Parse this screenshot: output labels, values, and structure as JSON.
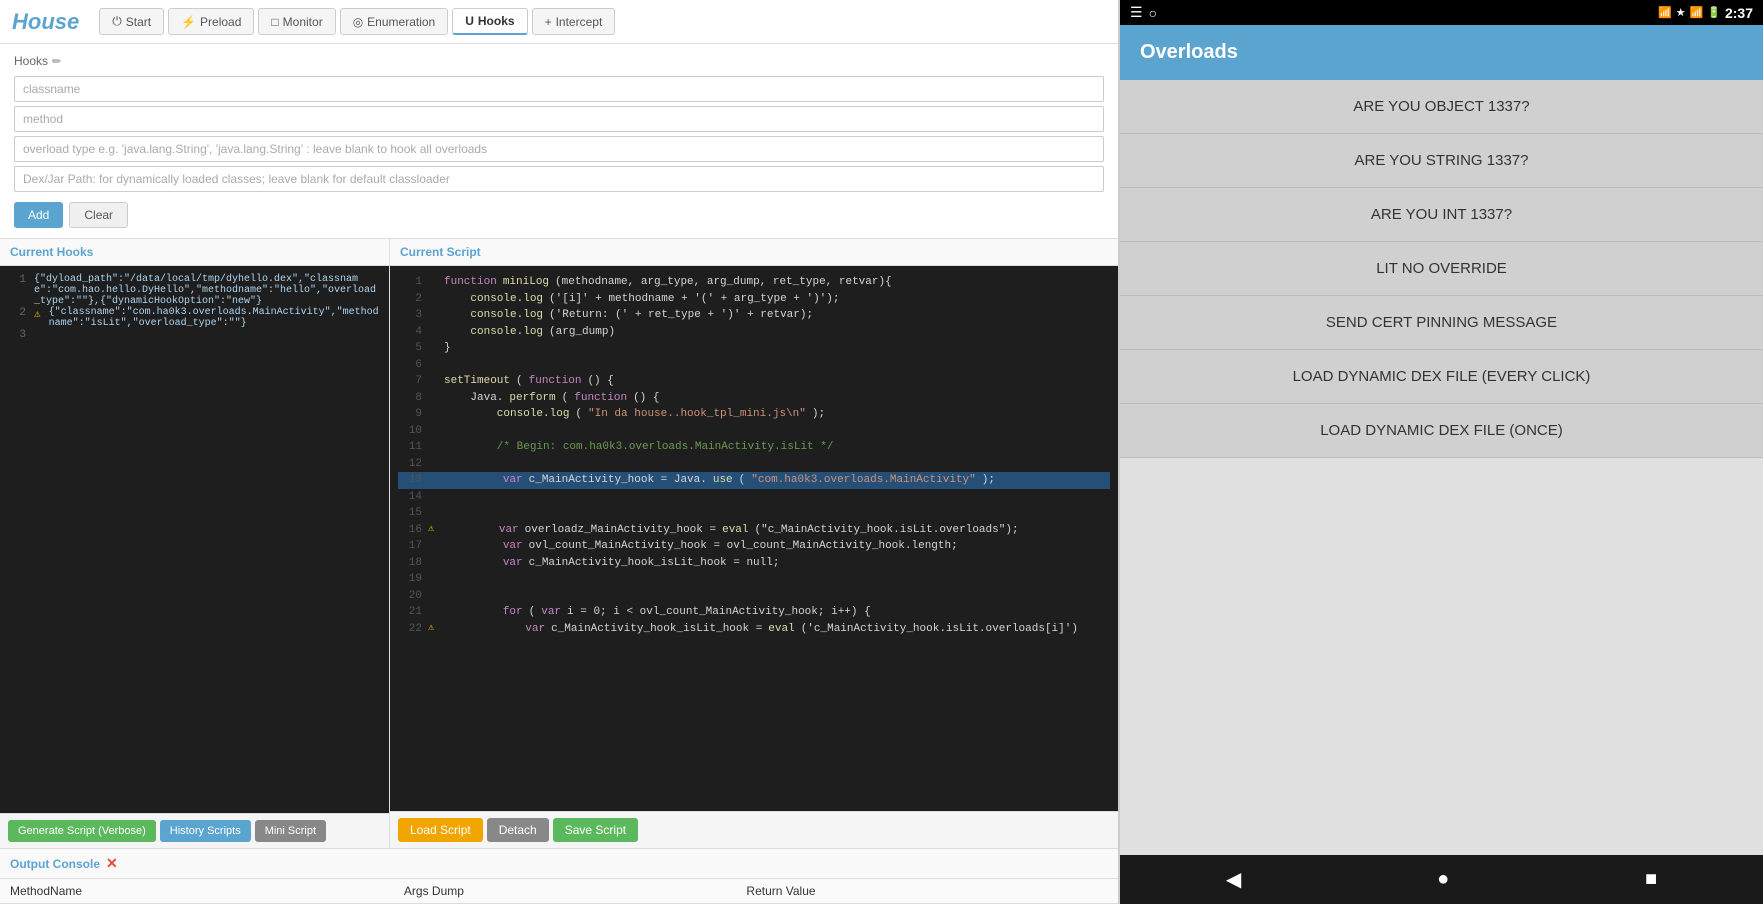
{
  "app": {
    "title": "House"
  },
  "nav": {
    "tabs": [
      {
        "id": "start",
        "label": "Start",
        "icon": "⏻",
        "active": false
      },
      {
        "id": "preload",
        "label": "Preload",
        "icon": "⚡",
        "active": false
      },
      {
        "id": "monitor",
        "label": "Monitor",
        "icon": "□",
        "active": false
      },
      {
        "id": "enumeration",
        "label": "Enumeration",
        "icon": "◎",
        "active": false
      },
      {
        "id": "hooks",
        "label": "Hooks",
        "icon": "U",
        "active": true
      },
      {
        "id": "intercept",
        "label": "Intercept",
        "icon": "+",
        "active": false
      }
    ]
  },
  "hooks": {
    "title": "Hooks",
    "fields": {
      "classname": {
        "placeholder": "classname",
        "value": ""
      },
      "method": {
        "placeholder": "method",
        "value": ""
      },
      "overload": {
        "placeholder": "overload type e.g. 'java.lang.String', 'java.lang.String' : leave blank to hook all overloads",
        "value": ""
      },
      "dexjar": {
        "placeholder": "Dex/Jar Path: for dynamically loaded classes; leave blank for default classloader",
        "value": ""
      }
    },
    "buttons": {
      "add": "Add",
      "clear": "Clear"
    }
  },
  "current_hooks": {
    "title": "Current Hooks",
    "code": [
      {
        "ln": "1",
        "warn": false,
        "text": "{\"dyload_path\":\"/data/local/tmp/dyhello.dex\",\"classname\":\"com.hao.hello.DyHello\",\"methodname\":\"hello\",\"overload_type\":\"\"},{\"dynamicHookOption\":\"new\"}"
      },
      {
        "ln": "2",
        "warn": true,
        "text": "{\"classname\":\"com.ha0k3.overloads.MainActivity\",\"methodname\":\"isLit\",\"overload_type\":\"\"}"
      },
      {
        "ln": "3",
        "warn": false,
        "text": ""
      }
    ],
    "buttons": {
      "generate": "Generate Script (Verbose)",
      "history": "History Scripts",
      "mini": "Mini Script"
    }
  },
  "current_script": {
    "title": "Current Script",
    "lines": [
      {
        "ln": "1",
        "warn": false,
        "highlight": false,
        "tokens": [
          {
            "t": "kw",
            "v": "function "
          },
          {
            "t": "fn",
            "v": "miniLog"
          },
          {
            "t": "plain",
            "v": "(methodname, arg_type, arg_dump, ret_type, retvar){"
          }
        ]
      },
      {
        "ln": "2",
        "warn": false,
        "highlight": false,
        "tokens": [
          {
            "t": "fn",
            "v": "    console.log"
          },
          {
            "t": "plain",
            "v": "('[i]' + methodname + '(' + arg_type + ')');"
          }
        ]
      },
      {
        "ln": "3",
        "warn": false,
        "highlight": false,
        "tokens": [
          {
            "t": "fn",
            "v": "    console.log"
          },
          {
            "t": "plain",
            "v": "('Return: (' + ret_type + ')' + retvar);"
          }
        ]
      },
      {
        "ln": "4",
        "warn": false,
        "highlight": false,
        "tokens": [
          {
            "t": "fn",
            "v": "    console.log"
          },
          {
            "t": "plain",
            "v": "(arg_dump)"
          }
        ]
      },
      {
        "ln": "5",
        "warn": false,
        "highlight": false,
        "tokens": [
          {
            "t": "plain",
            "v": "}"
          }
        ]
      },
      {
        "ln": "6",
        "warn": false,
        "highlight": false,
        "tokens": []
      },
      {
        "ln": "7",
        "warn": false,
        "highlight": false,
        "tokens": [
          {
            "t": "fn",
            "v": "setTimeout"
          },
          {
            "t": "plain",
            "v": "("
          },
          {
            "t": "kw",
            "v": "function"
          },
          {
            "t": "plain",
            "v": "() {"
          }
        ]
      },
      {
        "ln": "8",
        "warn": false,
        "highlight": false,
        "tokens": [
          {
            "t": "plain",
            "v": "    Java."
          },
          {
            "t": "fn",
            "v": "perform"
          },
          {
            "t": "plain",
            "v": "("
          },
          {
            "t": "kw",
            "v": "function"
          },
          {
            "t": "plain",
            "v": "() {"
          }
        ]
      },
      {
        "ln": "9",
        "warn": false,
        "highlight": false,
        "tokens": [
          {
            "t": "fn",
            "v": "        console.log"
          },
          {
            "t": "plain",
            "v": "("
          },
          {
            "t": "str",
            "v": "\"In da house..hook_tpl_mini.js\\n\""
          },
          {
            "t": "plain",
            "v": ");"
          }
        ]
      },
      {
        "ln": "10",
        "warn": false,
        "highlight": false,
        "tokens": []
      },
      {
        "ln": "11",
        "warn": false,
        "highlight": false,
        "tokens": [
          {
            "t": "cm",
            "v": "        /* Begin: com.ha0k3.overloads.MainActivity.isLit */"
          }
        ]
      },
      {
        "ln": "12",
        "warn": false,
        "highlight": false,
        "tokens": []
      },
      {
        "ln": "13",
        "warn": false,
        "highlight": true,
        "tokens": [
          {
            "t": "plain",
            "v": "        "
          },
          {
            "t": "kw",
            "v": "var "
          },
          {
            "t": "plain",
            "v": "c_MainActivity_hook = Java."
          },
          {
            "t": "fn",
            "v": "use"
          },
          {
            "t": "plain",
            "v": "("
          },
          {
            "t": "str",
            "v": "\"com.ha0k3.overloads.MainActivity\""
          },
          {
            "t": "plain",
            "v": ");"
          }
        ]
      },
      {
        "ln": "14",
        "warn": false,
        "highlight": false,
        "tokens": []
      },
      {
        "ln": "15",
        "warn": false,
        "highlight": false,
        "tokens": []
      },
      {
        "ln": "16",
        "warn": true,
        "highlight": false,
        "tokens": [
          {
            "t": "plain",
            "v": "        "
          },
          {
            "t": "kw",
            "v": "var "
          },
          {
            "t": "plain",
            "v": "overloadz_MainActivity_hook = "
          },
          {
            "t": "fn",
            "v": "eval"
          },
          {
            "t": "plain",
            "v": "(\"c_MainActivity_hook.isLit.overloads\");"
          }
        ]
      },
      {
        "ln": "17",
        "warn": false,
        "highlight": false,
        "tokens": [
          {
            "t": "plain",
            "v": "        "
          },
          {
            "t": "kw",
            "v": "var "
          },
          {
            "t": "plain",
            "v": "ovl_count_MainActivity_hook = ovl_count_MainActivity_hook.length;"
          }
        ]
      },
      {
        "ln": "18",
        "warn": false,
        "highlight": false,
        "tokens": [
          {
            "t": "plain",
            "v": "        "
          },
          {
            "t": "kw",
            "v": "var "
          },
          {
            "t": "plain",
            "v": "c_MainActivity_hook_isLit_hook = null;"
          }
        ]
      },
      {
        "ln": "19",
        "warn": false,
        "highlight": false,
        "tokens": []
      },
      {
        "ln": "20",
        "warn": false,
        "highlight": false,
        "tokens": []
      },
      {
        "ln": "21",
        "warn": false,
        "highlight": false,
        "tokens": [
          {
            "t": "plain",
            "v": "        "
          },
          {
            "t": "kw",
            "v": "for "
          },
          {
            "t": "plain",
            "v": "("
          },
          {
            "t": "kw",
            "v": "var "
          },
          {
            "t": "plain",
            "v": "i = 0; i < ovl_count_MainActivity_hook; i++) {"
          }
        ]
      },
      {
        "ln": "22",
        "warn": true,
        "highlight": false,
        "tokens": [
          {
            "t": "plain",
            "v": "            "
          },
          {
            "t": "kw",
            "v": "var "
          },
          {
            "t": "plain",
            "v": "c_MainActivity_hook_isLit_hook = "
          },
          {
            "t": "fn",
            "v": "eval"
          },
          {
            "t": "plain",
            "v": "('c_MainActivity_hook.isLit.overloads[i]')"
          }
        ]
      }
    ],
    "buttons": {
      "load": "Load Script",
      "detach": "Detach",
      "save": "Save Script"
    }
  },
  "output_console": {
    "title": "Output Console",
    "columns": [
      "MethodName",
      "Args Dump",
      "Return Value"
    ],
    "rows": []
  },
  "phone": {
    "status_bar": {
      "left_icon": "☰",
      "time": "2:37",
      "icons": [
        "bluetooth",
        "signal",
        "wifi",
        "battery"
      ]
    },
    "header": {
      "title": "Overloads"
    },
    "overload_items": [
      "ARE YOU OBJECT 1337?",
      "ARE YOU STRING 1337?",
      "ARE YOU INT 1337?",
      "LIT NO OVERRIDE",
      "SEND CERT PINNING MESSAGE",
      "LOAD DYNAMIC DEX FILE (EVERY CLICK)",
      "LOAD DYNAMIC DEX FILE (ONCE)"
    ],
    "nav_buttons": [
      "◀",
      "●",
      "■"
    ]
  }
}
